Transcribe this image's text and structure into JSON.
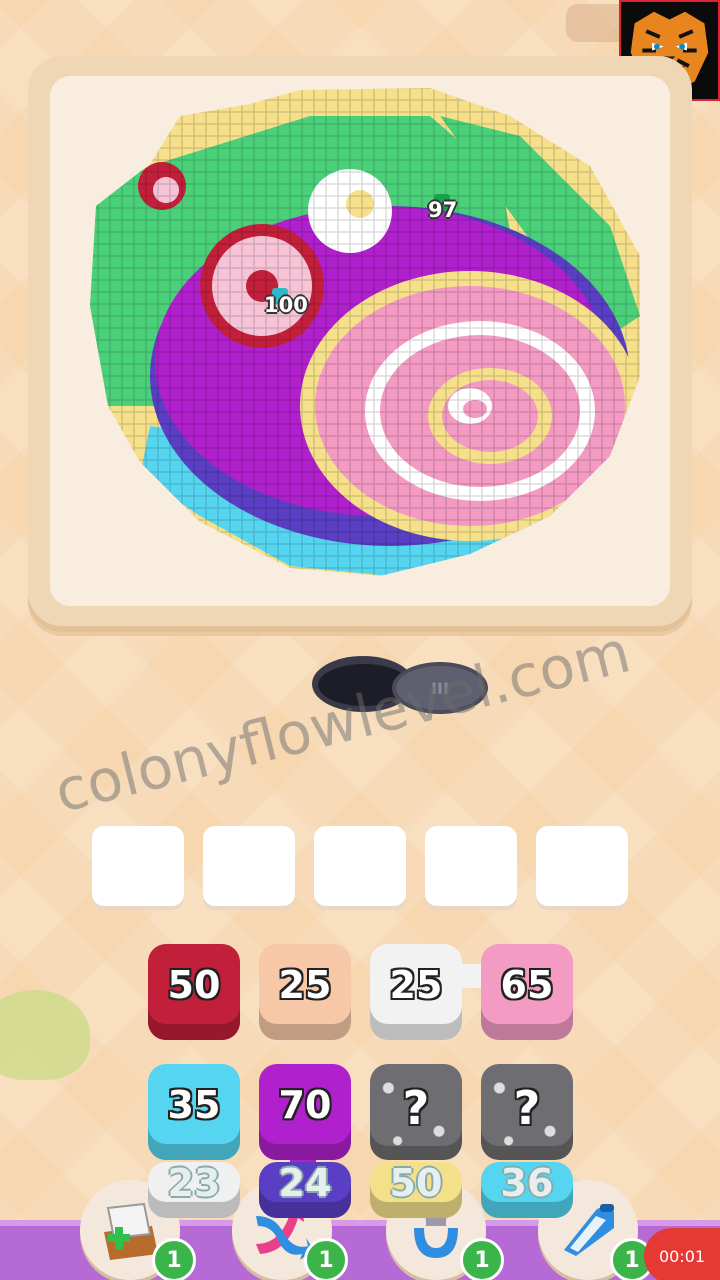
{
  "board": {
    "badges": [
      {
        "value": "97",
        "color": "#17a34a"
      },
      {
        "value": "100",
        "color": "#2fb8c8"
      }
    ]
  },
  "lid": {
    "label": "III"
  },
  "watermark": {
    "text": "colonyflowlevel.com"
  },
  "slots": {
    "count": 5
  },
  "tiles": [
    {
      "label": "50",
      "color": "#c21f3a",
      "row": 0,
      "col": 0
    },
    {
      "label": "25",
      "color": "#f6c8a8",
      "row": 0,
      "col": 1
    },
    {
      "label": "25",
      "color": "#f2f2f2",
      "row": 0,
      "col": 2
    },
    {
      "label": "65",
      "color": "#f49bc4",
      "row": 0,
      "col": 3
    },
    {
      "label": "35",
      "color": "#55d5ef",
      "row": 1,
      "col": 0
    },
    {
      "label": "70",
      "color": "#b020cc",
      "row": 1,
      "col": 1
    },
    {
      "label": "?",
      "color": "#6e6e72",
      "row": 1,
      "col": 2
    },
    {
      "label": "?",
      "color": "#6e6e72",
      "row": 1,
      "col": 3
    },
    {
      "label": "23",
      "color": "#f0f0f0",
      "row": 2,
      "col": 0
    },
    {
      "label": "24",
      "color": "#5a3fc4",
      "row": 2,
      "col": 1
    },
    {
      "label": "50",
      "color": "#f5e08a",
      "row": 2,
      "col": 2
    },
    {
      "label": "36",
      "color": "#55d5ef",
      "row": 2,
      "col": 3
    }
  ],
  "tools": [
    {
      "name": "add-tray",
      "count": "1"
    },
    {
      "name": "shuffle",
      "count": "1"
    },
    {
      "name": "magnet",
      "count": "1"
    },
    {
      "name": "vacuum",
      "count": "1"
    }
  ],
  "timer": {
    "text": "00:01"
  },
  "colors": {
    "background": "#f6d7b0",
    "board": "#efd6b4",
    "toolbar": "#b66ad6",
    "timer": "#e53935",
    "count_badge": "#3bb54a"
  }
}
